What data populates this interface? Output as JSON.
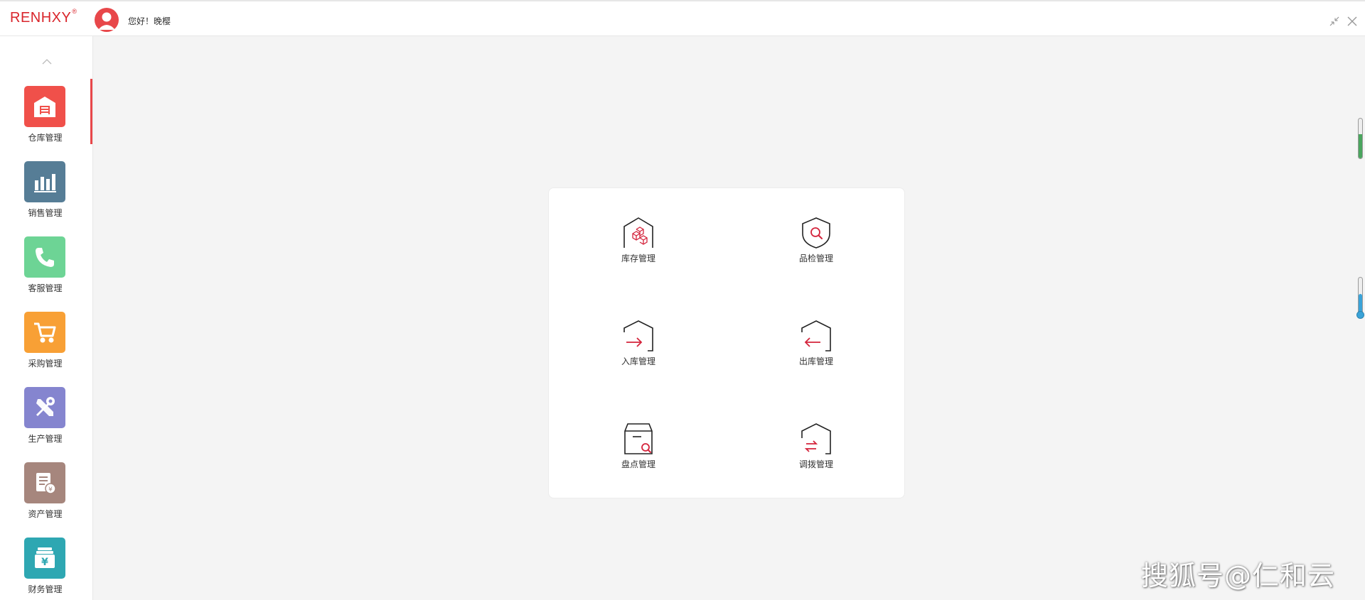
{
  "header": {
    "logo_text": "RENHXY",
    "logo_mark": "®",
    "greeting": "您好！晚樱",
    "avatar_icon": "user-avatar-icon",
    "minimize_icon": "shrink-icon",
    "close_icon": "close-icon"
  },
  "sidebar": {
    "items": [
      {
        "label": "仓库管理",
        "icon": "warehouse-icon",
        "color": "#f0504a"
      },
      {
        "label": "销售管理",
        "icon": "bar-chart-icon",
        "color": "#567d96"
      },
      {
        "label": "客服管理",
        "icon": "phone-icon",
        "color": "#6dd495"
      },
      {
        "label": "采购管理",
        "icon": "cart-icon",
        "color": "#f8a035"
      },
      {
        "label": "生产管理",
        "icon": "tools-icon",
        "color": "#8585cf"
      },
      {
        "label": "资产管理",
        "icon": "asset-ledger-icon",
        "color": "#a6867d"
      },
      {
        "label": "财务管理",
        "icon": "yuan-money-icon",
        "color": "#2ea7b2"
      }
    ]
  },
  "panel": {
    "items": [
      {
        "label": "库存管理",
        "icon": "inventory-icon"
      },
      {
        "label": "品检管理",
        "icon": "quality-check-icon"
      },
      {
        "label": "入库管理",
        "icon": "stock-in-icon"
      },
      {
        "label": "出库管理",
        "icon": "stock-out-icon"
      },
      {
        "label": "盘点管理",
        "icon": "stocktake-icon"
      },
      {
        "label": "调拨管理",
        "icon": "transfer-icon"
      }
    ]
  },
  "watermark": "搜狐号@仁和云",
  "colors": {
    "brand": "#d9252b",
    "accent": "#e8474a",
    "background": "#f4f4f4"
  }
}
